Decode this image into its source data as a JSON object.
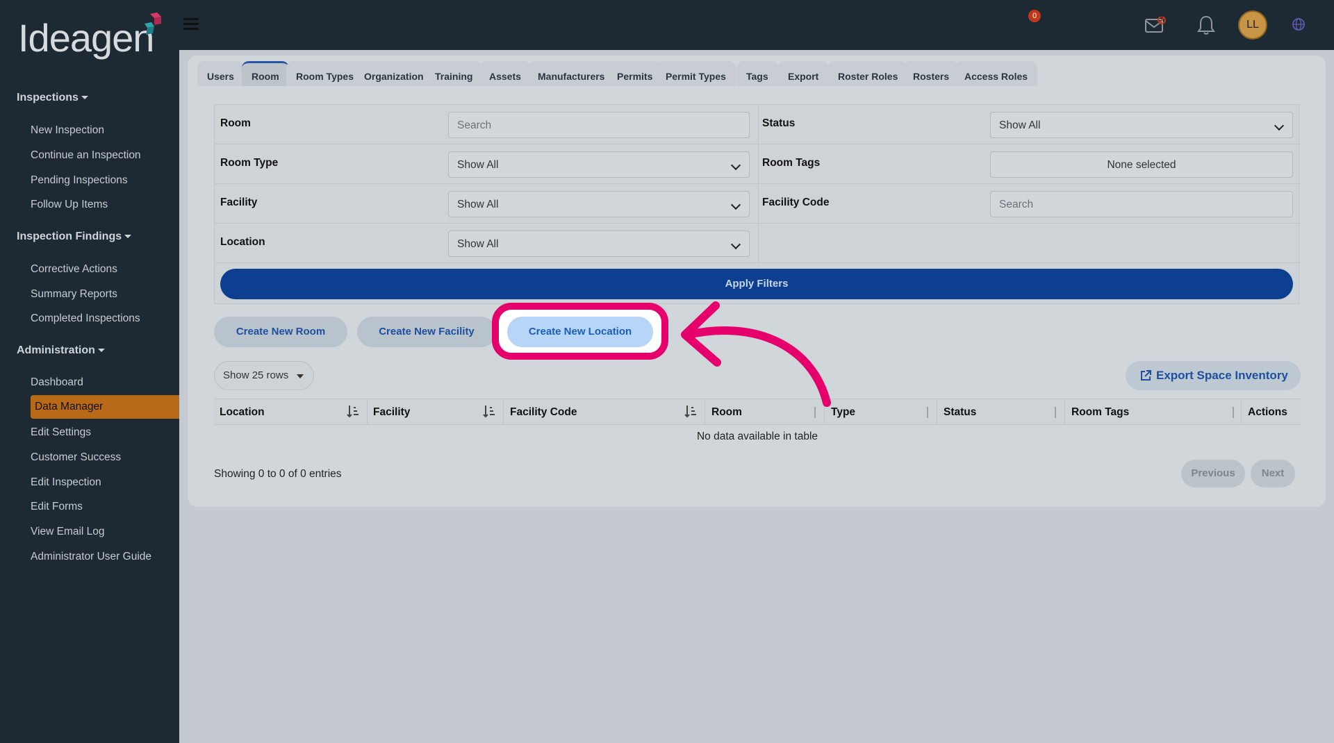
{
  "brand": {
    "name": "Ideagen",
    "accent": "#b86a18",
    "primary": "#0c3f8f",
    "highlight": "#e6006b"
  },
  "sidebar": {
    "sections": [
      {
        "title": "Inspections",
        "items": [
          "New Inspection",
          "Continue an Inspection",
          "Pending Inspections",
          "Follow Up Items"
        ]
      },
      {
        "title": "Inspection Findings",
        "items": [
          "Corrective Actions",
          "Summary Reports",
          "Completed Inspections"
        ]
      },
      {
        "title": "Administration",
        "items": [
          "Dashboard",
          "Data Manager",
          "Edit Settings",
          "Customer Success",
          "Edit Inspection",
          "Edit Forms",
          "View Email Log",
          "Administrator User Guide"
        ]
      }
    ],
    "active_item": "Data Manager"
  },
  "topbar": {
    "notification_count": "0",
    "avatar_initials": "LL"
  },
  "tabs": [
    "Users",
    "Room",
    "Room Types",
    "Organization",
    "Training",
    "Assets",
    "Manufacturers",
    "Permits",
    "Permit Types",
    "Tags",
    "Export",
    "Roster Roles",
    "Rosters",
    "Access Roles"
  ],
  "active_tab": "Room",
  "filters": {
    "room_label": "Room",
    "room_placeholder": "Search",
    "status_label": "Status",
    "status_value": "Show All",
    "room_type_label": "Room Type",
    "room_type_value": "Show All",
    "room_tags_label": "Room Tags",
    "room_tags_value": "None selected",
    "facility_label": "Facility",
    "facility_value": "Show All",
    "facility_code_label": "Facility Code",
    "facility_code_placeholder": "Search",
    "location_label": "Location",
    "location_value": "Show All",
    "apply_label": "Apply Filters"
  },
  "actions": {
    "create_room": "Create New Room",
    "create_facility": "Create New Facility",
    "create_location": "Create New Location"
  },
  "table": {
    "rows_label": "Show 25 rows",
    "export_label": "Export Space Inventory",
    "columns": [
      "Location",
      "Facility",
      "Facility Code",
      "Room",
      "Type",
      "Status",
      "Room Tags",
      "Actions"
    ],
    "empty_message": "No data available in table",
    "info": "Showing 0 to 0 of 0 entries",
    "prev_label": "Previous",
    "next_label": "Next"
  }
}
